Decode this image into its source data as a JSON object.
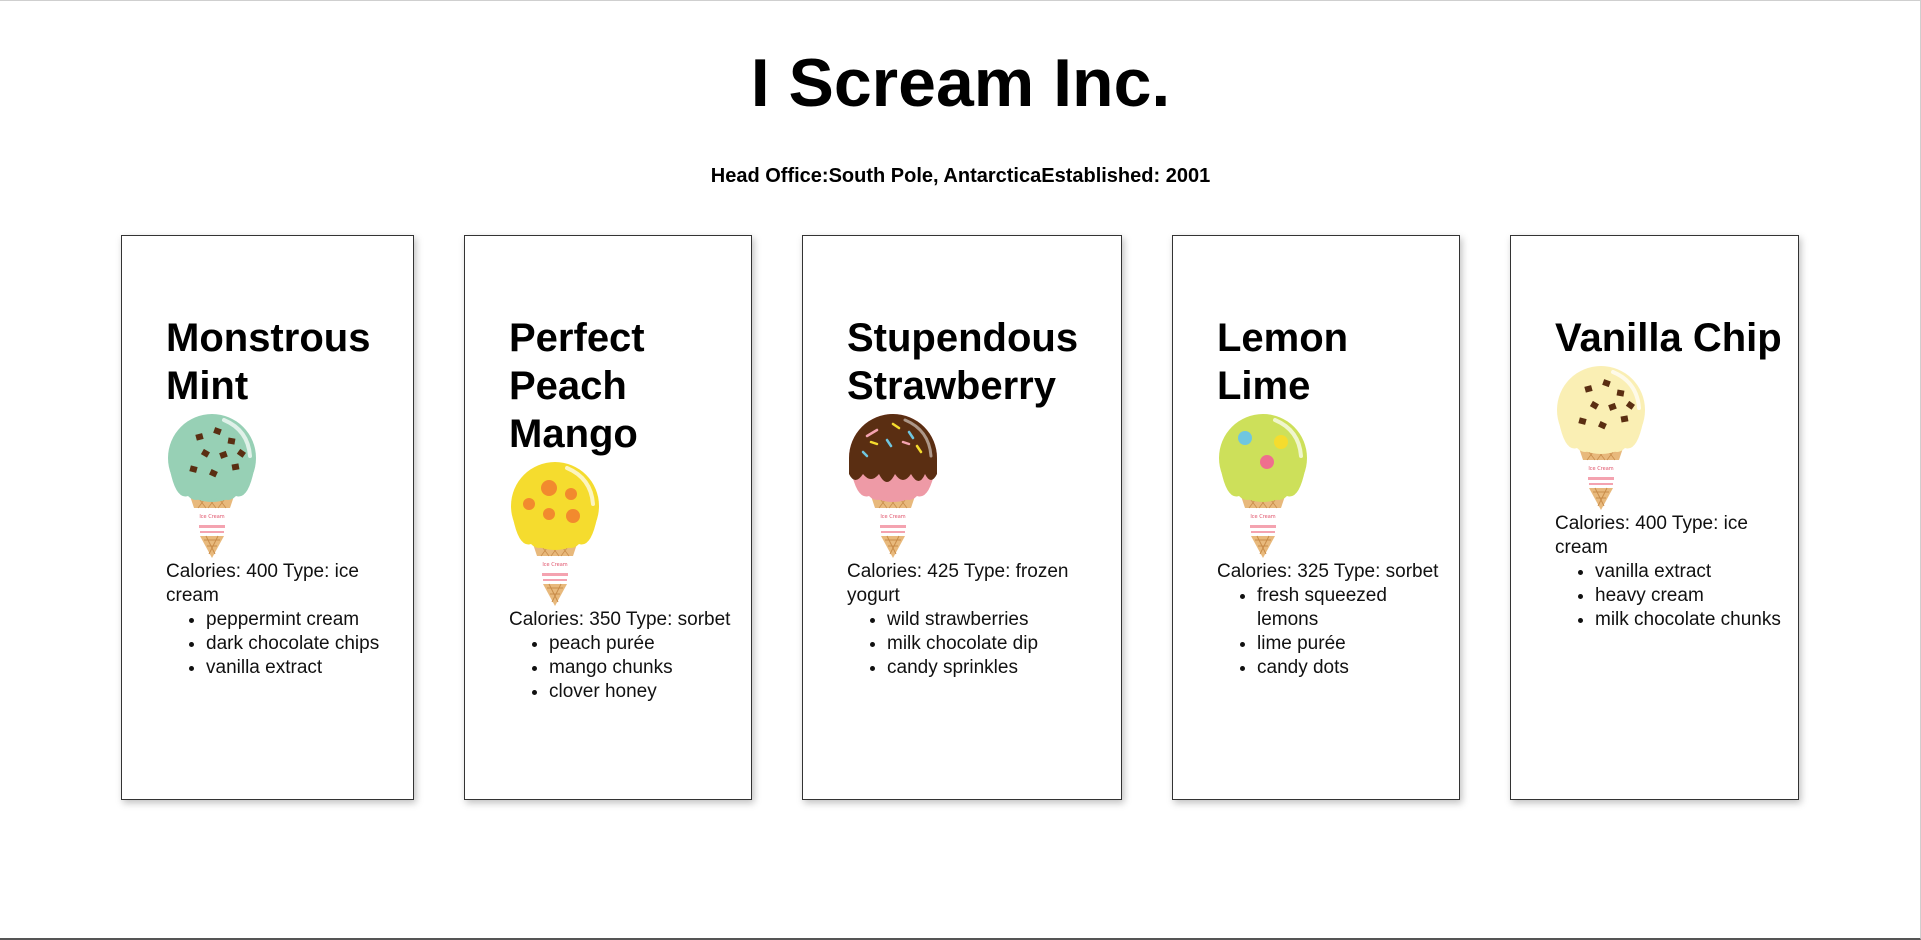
{
  "header": {
    "title": "I Scream Inc.",
    "head_office_label": "Head Office:",
    "head_office": "South Pole, Antarctica",
    "established_label": "Established: ",
    "established": "2001",
    "cone_label": "Ice Cream"
  },
  "flavors": [
    {
      "name": "Monstrous Mint",
      "calories_label": "Calories: ",
      "calories": "400",
      "type_label": " Type: ",
      "type": "ice cream",
      "ingredients": [
        "peppermint cream",
        "dark chocolate chips",
        "vanilla extract"
      ],
      "scoop_color": "#97d0b5",
      "topping": "chips"
    },
    {
      "name": "Perfect Peach Mango",
      "calories_label": "Calories: ",
      "calories": "350",
      "type_label": " Type: ",
      "type": "sorbet",
      "ingredients": [
        "peach purée",
        "mango chunks",
        "clover honey"
      ],
      "scoop_color": "#f5dc2e",
      "topping": "orange-dots"
    },
    {
      "name": "Stupendous Strawberry",
      "calories_label": "Calories: ",
      "calories": "425",
      "type_label": " Type: ",
      "type": "frozen yogurt",
      "ingredients": [
        "wild strawberries",
        "milk chocolate dip",
        "candy sprinkles"
      ],
      "scoop_color": "#ee9aa6",
      "topping": "chocolate-dip-sprinkles"
    },
    {
      "name": "Lemon Lime",
      "calories_label": "Calories: ",
      "calories": "325",
      "type_label": " Type: ",
      "type": "sorbet",
      "ingredients": [
        "fresh squeezed lemons",
        "lime purée",
        "candy dots"
      ],
      "scoop_color": "#cde05a",
      "topping": "candy-dots"
    },
    {
      "name": "Vanilla Chip",
      "calories_label": "Calories: ",
      "calories": "400",
      "type_label": " Type: ",
      "type": "ice cream",
      "ingredients": [
        "vanilla extract",
        "heavy cream",
        "milk chocolate chunks"
      ],
      "scoop_color": "#faefb4",
      "topping": "chips"
    }
  ]
}
